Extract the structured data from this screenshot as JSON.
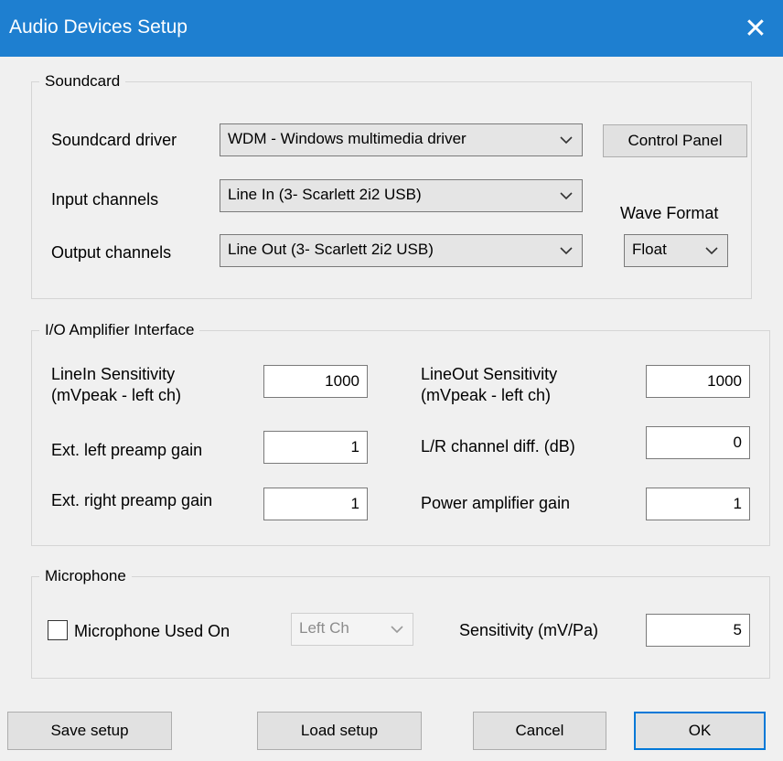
{
  "window": {
    "title": "Audio Devices Setup",
    "close_glyph": "✕"
  },
  "soundcard": {
    "legend": "Soundcard",
    "driver_label": "Soundcard driver",
    "driver_value": "WDM - Windows multimedia driver",
    "control_panel_label": "Control Panel",
    "input_label": "Input channels",
    "input_value": "Line In (3- Scarlett 2i2 USB)",
    "output_label": "Output channels",
    "output_value": "Line Out (3- Scarlett 2i2 USB)",
    "wave_format_label": "Wave Format",
    "wave_format_value": "Float"
  },
  "io": {
    "legend": "I/O Amplifier Interface",
    "linein_label1": "LineIn Sensitivity",
    "linein_label2": "(mVpeak - left ch)",
    "linein_value": "1000",
    "ext_left_label": "Ext. left preamp gain",
    "ext_left_value": "1",
    "ext_right_label": "Ext. right preamp gain",
    "ext_right_value": "1",
    "lineout_label1": "LineOut Sensitivity",
    "lineout_label2": "(mVpeak - left ch)",
    "lineout_value": "1000",
    "lr_diff_label": "L/R channel diff. (dB)",
    "lr_diff_value": "0",
    "power_amp_label": "Power amplifier gain",
    "power_amp_value": "1"
  },
  "microphone": {
    "legend": "Microphone",
    "used_on_label": "Microphone Used On",
    "used_on_checked": false,
    "channel_value": "Left Ch",
    "sensitivity_label": "Sensitivity (mV/Pa)",
    "sensitivity_value": "5"
  },
  "buttons": {
    "save": "Save setup",
    "load": "Load setup",
    "cancel": "Cancel",
    "ok": "OK"
  },
  "colors": {
    "titlebar": "#1e7fd0",
    "default_button_border": "#0078d7"
  },
  "icons": {
    "dropdown": "chevron-down-icon",
    "close": "close-icon"
  }
}
